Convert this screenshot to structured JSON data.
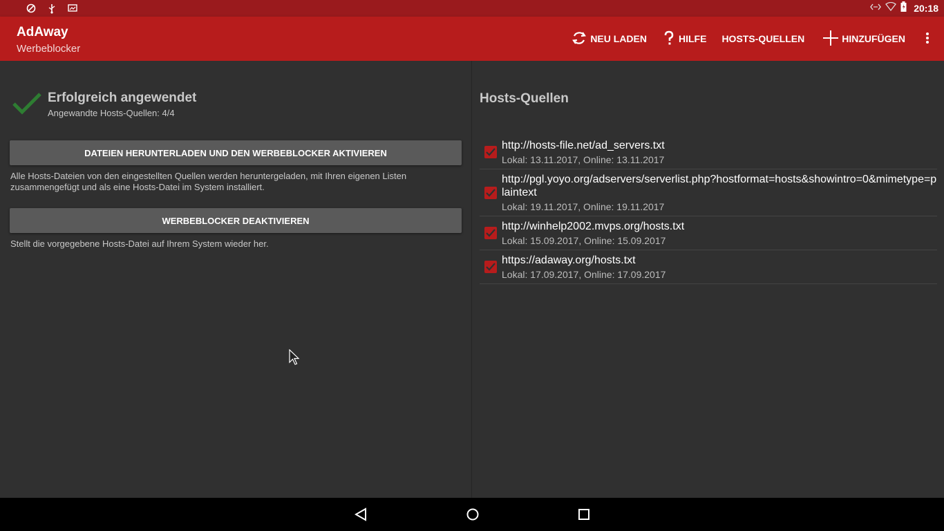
{
  "statusbar": {
    "time": "20:18",
    "left_icons": [
      "screen-rotation-icon",
      "usb-icon",
      "cast-icon"
    ],
    "right_icons": [
      "data-transfer-icon",
      "wifi-icon",
      "battery-icon"
    ]
  },
  "appbar": {
    "title": "AdAway",
    "subtitle": "Werbeblocker",
    "actions": [
      {
        "label": "NEU LADEN",
        "icon": "refresh-icon"
      },
      {
        "label": "HILFE",
        "icon": "help-icon"
      },
      {
        "label": "HOSTS-QUELLEN",
        "icon": ""
      },
      {
        "label": "HINZUFÜGEN",
        "icon": "plus-icon"
      }
    ],
    "overflow_icon": "more-vert-icon"
  },
  "status": {
    "title": "Erfolgreich angewendet",
    "subtitle": "Angewandte Hosts-Quellen: 4/4",
    "icon": "checkmark-icon"
  },
  "buttons": {
    "enable_label": "DATEIEN HERUNTERLADEN UND DEN WERBEBLOCKER AKTIVIEREN",
    "enable_desc": "Alle Hosts-Dateien von den eingestellten Quellen werden heruntergeladen, mit Ihren eigenen Listen zusammengefügt und als eine Hosts-Datei im System installiert.",
    "disable_label": "WERBEBLOCKER DEAKTIVIEREN",
    "disable_desc": "Stellt die vorgegebene Hosts-Datei auf Ihrem System wieder her."
  },
  "hosts": {
    "title": "Hosts-Quellen",
    "items": [
      {
        "url": "http://hosts-file.net/ad_servers.txt",
        "dates": "Lokal: 13.11.2017, Online: 13.11.2017",
        "checked": true
      },
      {
        "url": "http://pgl.yoyo.org/adservers/serverlist.php?hostformat=hosts&showintro=0&mimetype=plaintext",
        "dates": "Lokal: 19.11.2017, Online: 19.11.2017",
        "checked": true
      },
      {
        "url": "http://winhelp2002.mvps.org/hosts.txt",
        "dates": "Lokal: 15.09.2017, Online: 15.09.2017",
        "checked": true
      },
      {
        "url": "https://adaway.org/hosts.txt",
        "dates": "Lokal: 17.09.2017, Online: 17.09.2017",
        "checked": true
      }
    ]
  },
  "navbar": {
    "icons": [
      "back-icon",
      "home-icon",
      "recents-icon"
    ]
  },
  "colors": {
    "statusbar": "#9a1a1d",
    "appbar": "#b71c1c",
    "background": "#303030",
    "check_green": "#2e7d32",
    "checkbox_red": "#b71c1c"
  }
}
